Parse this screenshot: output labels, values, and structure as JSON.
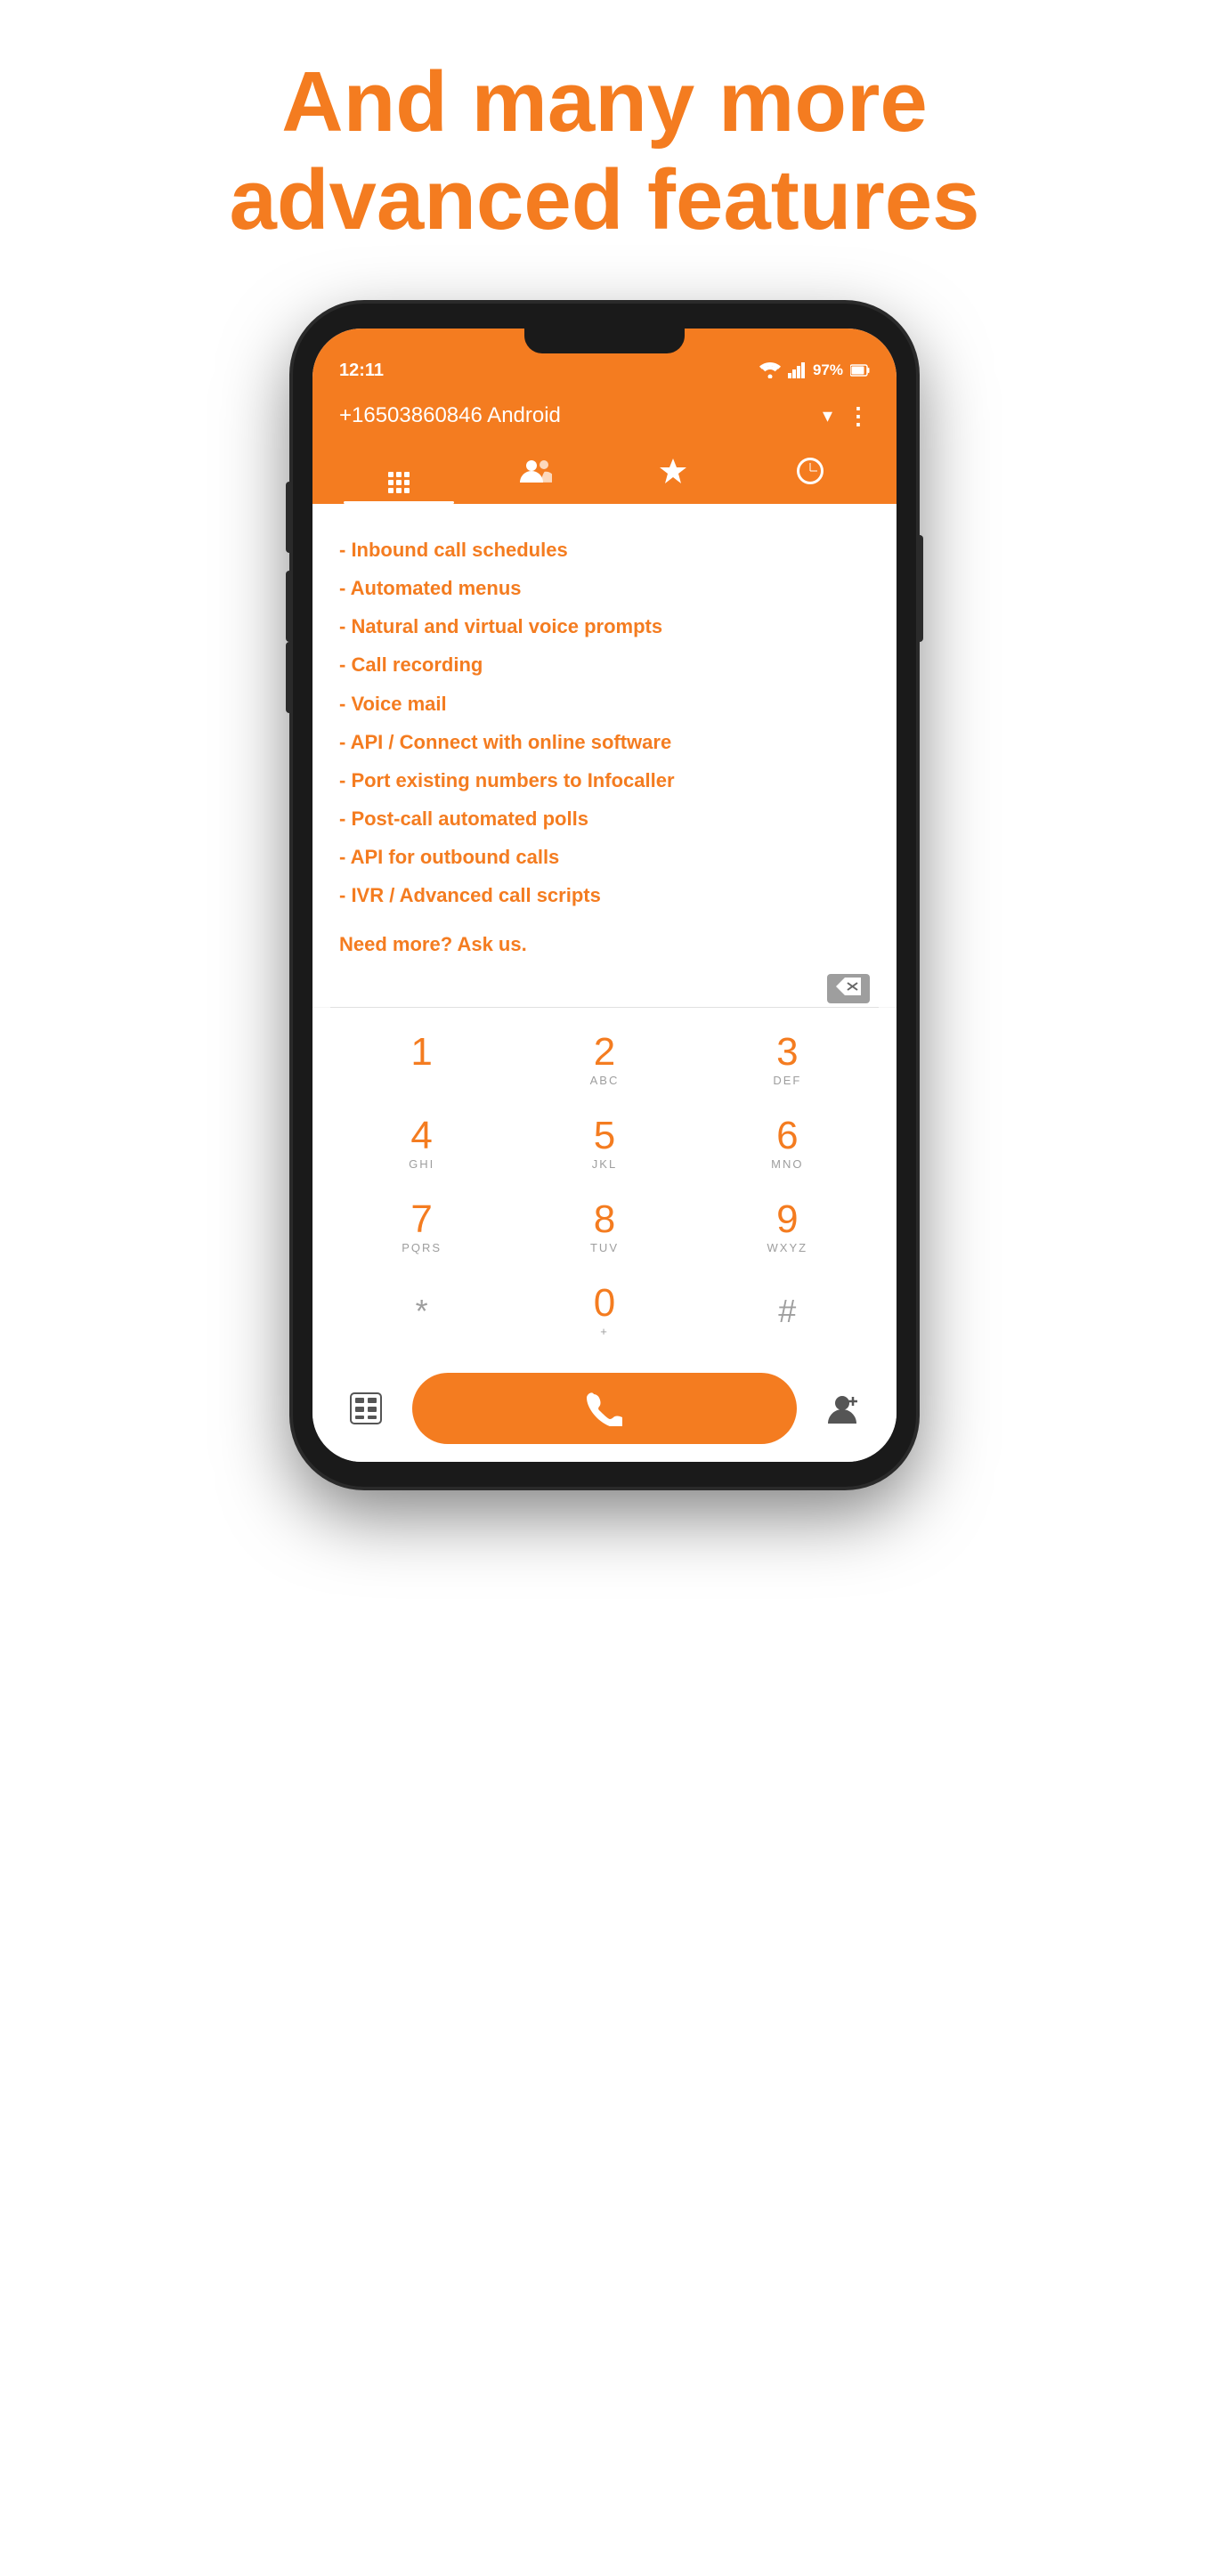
{
  "headline": {
    "line1": "And many more",
    "line2": "advanced features"
  },
  "phone": {
    "status_bar": {
      "time": "12:11",
      "wifi": "WiFi",
      "signal": "signal",
      "battery": "97%"
    },
    "app_header": {
      "title": "+16503860846  Android",
      "dropdown_icon": "▾",
      "more_icon": "⋮"
    },
    "nav_tabs": [
      {
        "label": "dialpad",
        "icon": "dialpad",
        "active": true
      },
      {
        "label": "contacts",
        "icon": "people",
        "active": false
      },
      {
        "label": "favorites",
        "icon": "star",
        "active": false
      },
      {
        "label": "recents",
        "icon": "clock",
        "active": false
      }
    ],
    "features": [
      "- Inbound call schedules",
      "- Automated menus",
      "- Natural and virtual voice prompts",
      "- Call recording",
      "- Voice mail",
      "- API / Connect with online software",
      "- Port existing numbers to Infocaller",
      "- Post-call automated polls",
      "- API for outbound calls",
      "- IVR / Advanced call scripts"
    ],
    "ask_more": "Need more? Ask us.",
    "dialpad": {
      "keys": [
        {
          "digit": "1",
          "letters": ""
        },
        {
          "digit": "2",
          "letters": "ABC"
        },
        {
          "digit": "3",
          "letters": "DEF"
        },
        {
          "digit": "4",
          "letters": "GHI"
        },
        {
          "digit": "5",
          "letters": "JKL"
        },
        {
          "digit": "6",
          "letters": "MNO"
        },
        {
          "digit": "7",
          "letters": "PQRS"
        },
        {
          "digit": "8",
          "letters": "TUV"
        },
        {
          "digit": "9",
          "letters": "WXYZ"
        },
        {
          "digit": "*",
          "letters": ""
        },
        {
          "digit": "0",
          "letters": "+"
        },
        {
          "digit": "#",
          "letters": ""
        }
      ]
    },
    "bottom_bar": {
      "calculator_label": "calculator",
      "call_label": "call",
      "add_contact_label": "add contact"
    }
  },
  "colors": {
    "orange": "#f47c20",
    "dark": "#1a1a1a",
    "white": "#ffffff",
    "grey": "#9e9e9e"
  }
}
